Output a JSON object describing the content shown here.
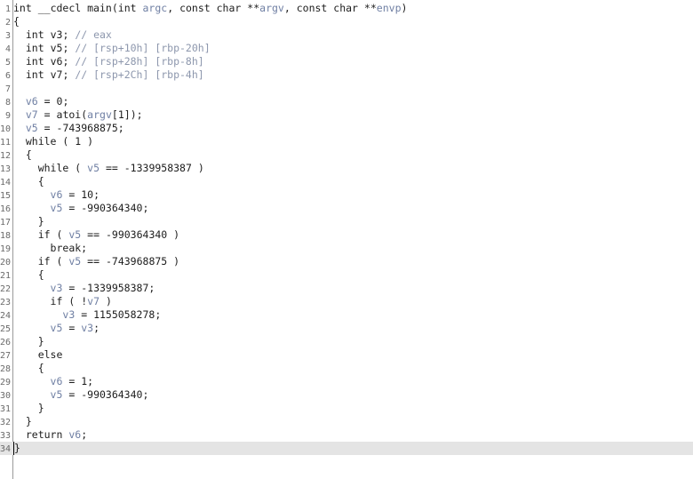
{
  "code_lines": [
    "int __cdecl main(int argc, const char **argv, const char **envp)",
    "{",
    "  int v3; // eax",
    "  int v5; // [rsp+10h] [rbp-20h]",
    "  int v6; // [rsp+28h] [rbp-8h]",
    "  int v7; // [rsp+2Ch] [rbp-4h]",
    "",
    "  v6 = 0;",
    "  v7 = atoi(argv[1]);",
    "  v5 = -743968875;",
    "  while ( 1 )",
    "  {",
    "    while ( v5 == -1339958387 )",
    "    {",
    "      v6 = 10;",
    "      v5 = -990364340;",
    "    }",
    "    if ( v5 == -990364340 )",
    "      break;",
    "    if ( v5 == -743968875 )",
    "    {",
    "      v3 = -1339958387;",
    "      if ( !v7 )",
    "        v3 = 1155058278;",
    "      v5 = v3;",
    "    }",
    "    else",
    "    {",
    "      v6 = 1;",
    "      v5 = -990364340;",
    "    }",
    "  }",
    "  return v6;",
    "}"
  ],
  "current_line": 34,
  "colors": {
    "text": "#1c1c1c",
    "variable": "#6f7fa3",
    "comment": "#8d97ad",
    "line_number": "#6a6a6a",
    "current_line_bg": "#e4e4e4"
  }
}
